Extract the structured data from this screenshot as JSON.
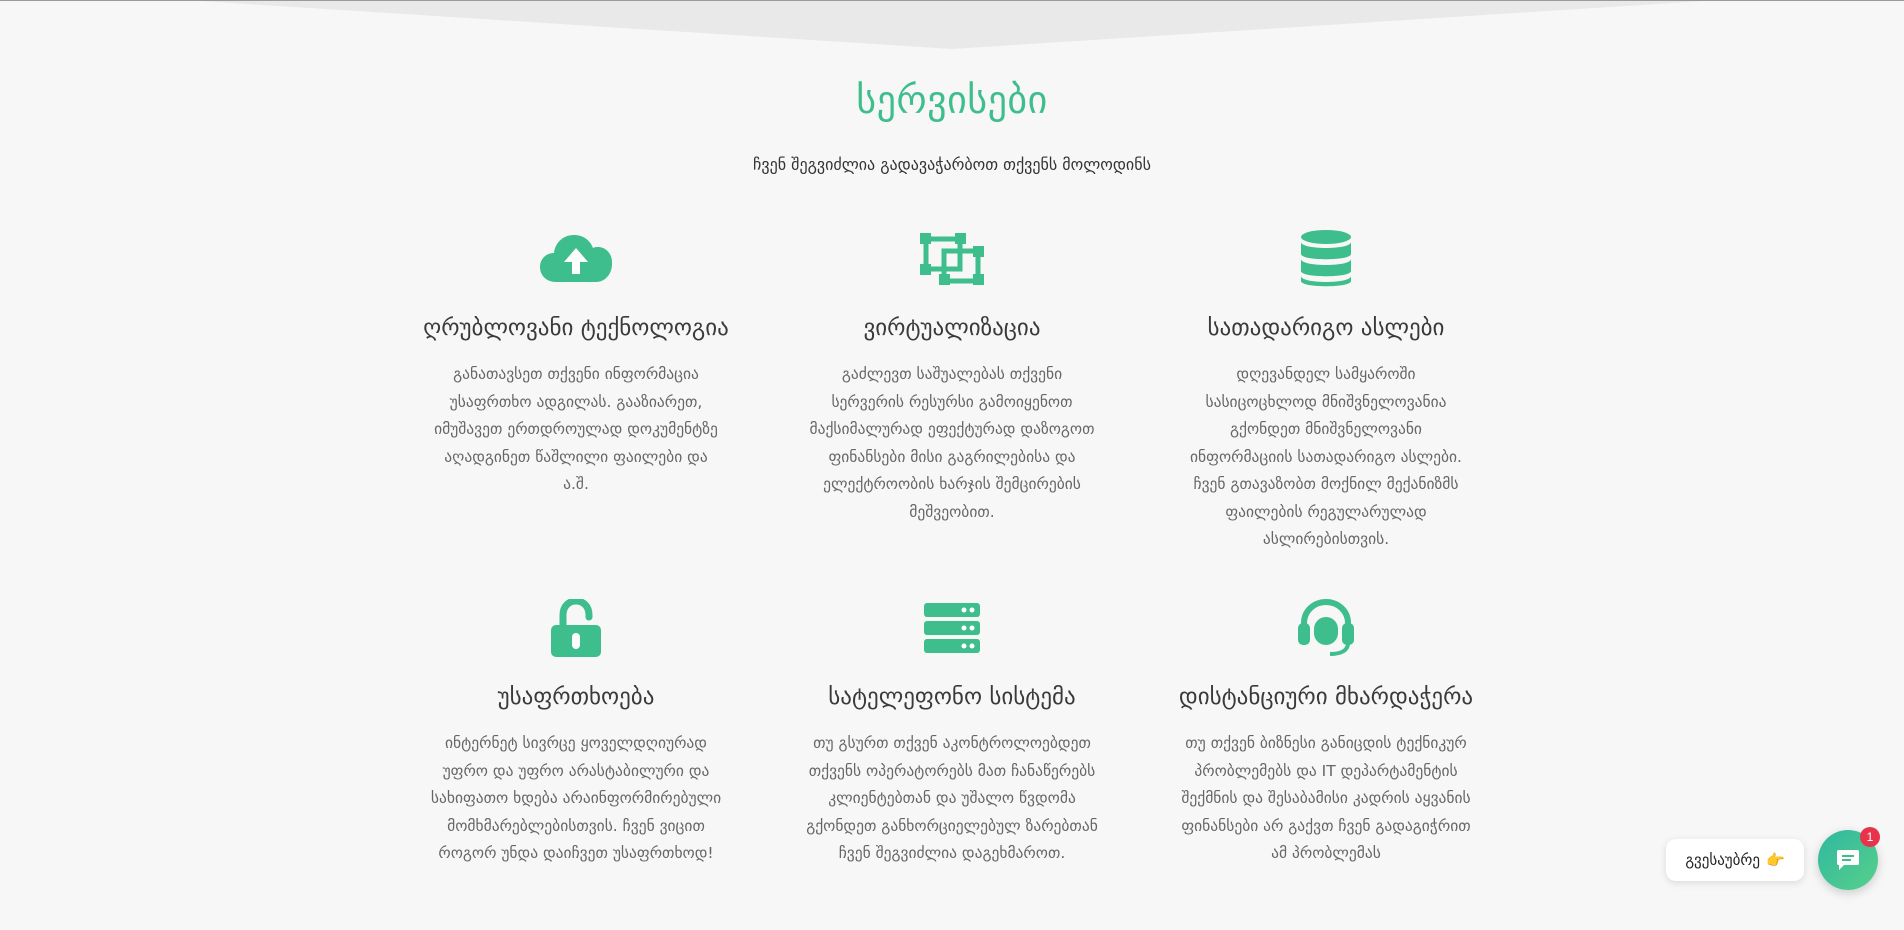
{
  "section": {
    "title": "სერვისები",
    "subtitle": "ჩვენ შეგვიძლია გადავაჭარბოთ თქვენს მოლოდინს"
  },
  "accent_color": "#3ebd8d",
  "services": [
    {
      "icon": "cloud-upload-icon",
      "title": "ღრუბლოვანი ტექნოლოგია",
      "description": "განათავსეთ თქვენი ინფორმაცია უსაფრთხო ადგილას. გააზიარეთ, იმუშავეთ ერთდროულად დოკუმენტზე აღადგინეთ წაშლილი ფაილები და ა.შ."
    },
    {
      "icon": "vector-square-icon",
      "title": "ვირტუალიზაცია",
      "description": "გაძლევთ საშუალებას თქვენი სერვერის რესურსი გამოიყენოთ მაქსიმალურად ეფექტურად დაზოგოთ ფინანსები მისი გაგრილებისა და ელექტროობის ხარჯის შემცირების მეშვეობით."
    },
    {
      "icon": "database-icon",
      "title": "სათადარიგო ასლები",
      "description": "დღევანდელ სამყაროში სასიცოცხლოდ მნიშვნელოვანია გქონდეთ მნიშვნელოვანი ინფორმაციის სათადარიგო ასლები. ჩვენ გთავაზობთ მოქნილ მექანიზმს ფაილების რეგულარულად ასლირებისთვის."
    },
    {
      "icon": "unlock-icon",
      "title": "უსაფრთხოება",
      "description": "ინტერნეტ სივრცე ყოველდღიურად უფრო და უფრო არასტაბილური და სახიფათო ხდება არაინფორმირებული მომხმარებლებისთვის. ჩვენ ვიცით როგორ უნდა დაიჩვეთ უსაფრთხოდ!"
    },
    {
      "icon": "server-icon",
      "title": "სატელეფონო სისტემა",
      "description": "თუ გსურთ თქვენ აკონტროლოებდეთ თქვენს ოპერატორებს მათ ჩანაწერებს კლიენტებთან და უშალო წვდომა გქონდეთ განხორციელებულ ზარებთან ჩვენ შეგვიძლია დაგეხმაროთ."
    },
    {
      "icon": "headset-icon",
      "title": "დისტანციური მხარდაჭერა",
      "description": "თუ თქვენ ბიზნესი განიცდის ტექნიკურ პრობლემებს და IT დეპარტამენტის შექმნის და შესაბამისი კადრის აყვანის ფინანსები არ გაქვთ ჩვენ გადაგიჭრით ამ პრობლემას"
    }
  ],
  "chat": {
    "bubble_text": "გვესაუბრე",
    "bubble_emoji": "👉",
    "badge_count": "1"
  }
}
